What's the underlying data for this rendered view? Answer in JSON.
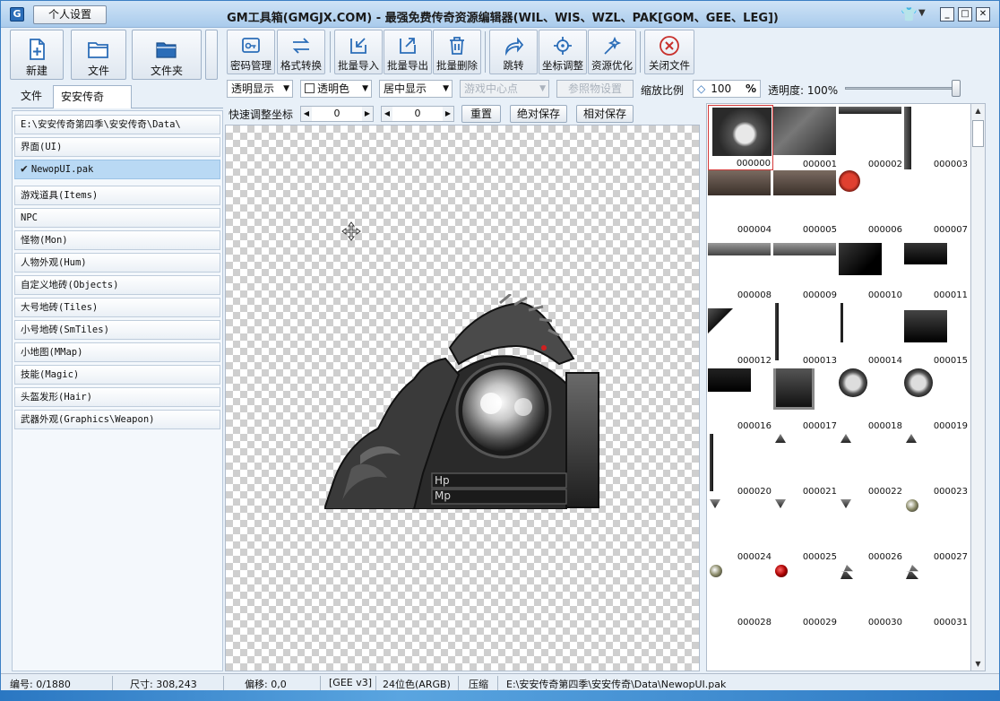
{
  "titlebar": {
    "personal_button": "个人设置",
    "title": "GM工具箱(GMGJX.COM) - 最强免费传奇资源编辑器(WIL、WIS、WZL、PAK[GOM、GEE、LEG])",
    "minimize": "_",
    "maximize": "□",
    "close": "✕"
  },
  "left_toolbar": {
    "new_label": "新建",
    "file_label": "文件",
    "folder_label": "文件夹"
  },
  "left_tabs": {
    "file_tab": "文件",
    "game_tab": "安安传奇",
    "close_glyph": "✕"
  },
  "tree": {
    "items": [
      "E:\\安安传奇第四季\\安安传奇\\Data\\",
      "界面(UI)",
      "NewopUI.pak",
      "游戏道具(Items)",
      "NPC",
      "怪物(Mon)",
      "人物外观(Hum)",
      "自定义地砖(Objects)",
      "大号地砖(Tiles)",
      "小号地砖(SmTiles)",
      "小地图(MMap)",
      "技能(Magic)",
      "头盔发形(Hair)",
      "武器外观(Graphics\\Weapon)"
    ]
  },
  "toolbar": {
    "buttons": [
      "密码管理",
      "格式转换",
      "批量导入",
      "批量导出",
      "批量删除",
      "跳转",
      "坐标调整",
      "资源优化",
      "关闭文件"
    ]
  },
  "options": {
    "transparent_display": "透明显示",
    "transparent_color": "透明色",
    "center_display": "居中显示",
    "game_center": "游戏中心点",
    "reference_settings": "参照物设置",
    "zoom_label": "缩放比例",
    "zoom_value": "100",
    "zoom_unit": "%",
    "opacity_label": "透明度: 100%",
    "opacity": 1.0
  },
  "coords": {
    "label": "快速调整坐标",
    "x": "0",
    "y": "0",
    "reset": "重置",
    "absolute_save": "绝对保存",
    "relative_save": "相对保存"
  },
  "sprite": {
    "hp": "Hp",
    "mp": "Mp"
  },
  "thumbnails": [
    "000000",
    "000001",
    "000002",
    "000003",
    "000004",
    "000005",
    "000006",
    "000007",
    "000008",
    "000009",
    "000010",
    "000011",
    "000012",
    "000013",
    "000014",
    "000015",
    "000016",
    "000017",
    "000018",
    "000019",
    "000020",
    "000021",
    "000022",
    "000023",
    "000024",
    "000025",
    "000026",
    "000027",
    "000028",
    "000029",
    "000030",
    "000031"
  ],
  "status": {
    "index": "编号: 0/1880",
    "size": "尺寸: 308,243",
    "offset": "偏移: 0,0",
    "format": "[GEE v3]",
    "color_depth": "24位色(ARGB)",
    "compress": "压缩",
    "path": "E:\\安安传奇第四季\\安安传奇\\Data\\NewopUI.pak"
  },
  "colors": {
    "accent": "#2b6db8",
    "selected": "#b9d9f4",
    "close_red": "#c8302c"
  }
}
